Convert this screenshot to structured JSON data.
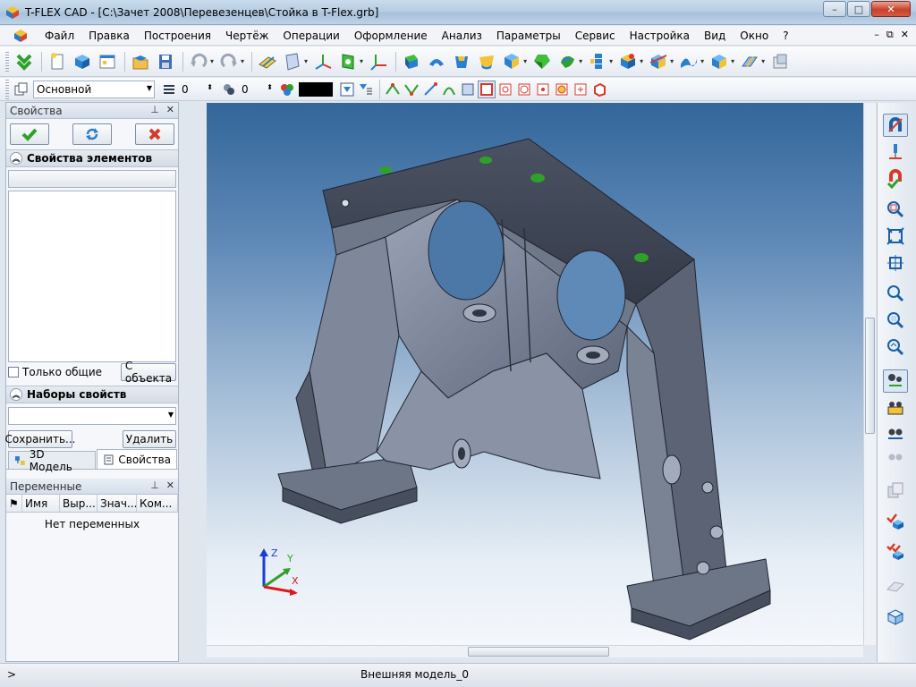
{
  "window": {
    "app_name": "T-FLEX CAD",
    "title": "T-FLEX CAD - [C:\\Зачет 2008\\Перевезенцев\\Стойка в T-Flex.grb]",
    "minimize": "–",
    "maximize": "□",
    "close": "✕"
  },
  "menu": {
    "items": [
      "Файл",
      "Правка",
      "Построения",
      "Чертёж",
      "Операции",
      "Оформление",
      "Анализ",
      "Параметры",
      "Сервис",
      "Настройка",
      "Вид",
      "Окно",
      "?"
    ],
    "mdi_minimize": "–",
    "mdi_restore": "⧉",
    "mdi_close": "✕"
  },
  "toolbar2": {
    "layer_value": "Основной",
    "level_value": "0",
    "priority_value": "0",
    "color_value": "#000000"
  },
  "properties_panel": {
    "title": "Свойства",
    "pin": "⊥",
    "close": "✕",
    "section_elements": "Свойства элементов",
    "only_common": "Только общие",
    "from_object": "С объекта",
    "section_sets": "Наборы свойств",
    "save": "Сохранить...",
    "delete": "Удалить"
  },
  "tabs": [
    {
      "label": "3D Модель",
      "active": false
    },
    {
      "label": "Свойства",
      "active": true
    }
  ],
  "variables_panel": {
    "title": "Переменные",
    "pin": "⊥",
    "close": "✕",
    "columns": [
      "Имя",
      "Выр...",
      "Знач...",
      "Ком..."
    ],
    "empty_text": "Нет переменных"
  },
  "axes": {
    "z": "Z",
    "y": "Y",
    "x": "X"
  },
  "status": {
    "prompt": ">",
    "text": "Внешняя модель_0"
  },
  "colors": {
    "accent": "#2a7fd0",
    "green": "#2fa12a",
    "red": "#d83a2a",
    "model_steel": "#8893a6"
  }
}
